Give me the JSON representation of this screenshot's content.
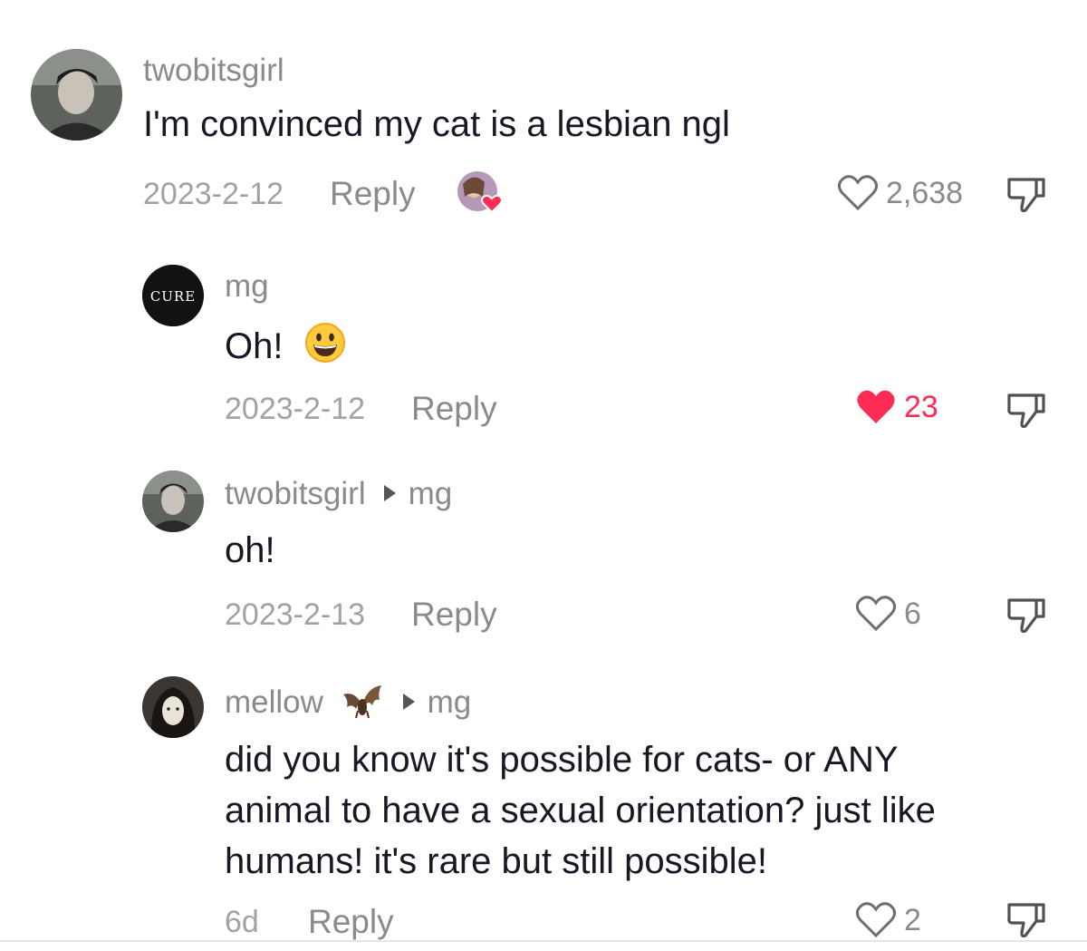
{
  "comments": [
    {
      "username": "twobitsgirl",
      "text": "I'm convinced my cat is a lesbian ngl",
      "date": "2023-2-12",
      "reply_label": "Reply",
      "likes": "2,638",
      "liked": false
    },
    {
      "username": "mg",
      "avatar_text": "CURE",
      "text": "Oh!",
      "emoji": "😀",
      "date": "2023-2-12",
      "reply_label": "Reply",
      "likes": "23",
      "liked": true
    },
    {
      "username": "twobitsgirl",
      "reply_to": "mg",
      "text": "oh!",
      "date": "2023-2-13",
      "reply_label": "Reply",
      "likes": "6",
      "liked": false
    },
    {
      "username": "mellow",
      "badge_emoji": "🦇",
      "reply_to": "mg",
      "text_lines": [
        "did you know it's possible for cats- or ANY",
        "animal to have a sexual orientation? just like",
        "humans! it's rare but still possible!"
      ],
      "date": "6d",
      "reply_label": "Reply",
      "likes": "2",
      "liked": false
    }
  ],
  "icons": {
    "like": "heart-outline-icon",
    "liked": "heart-filled-icon",
    "dislike": "thumbs-down-icon",
    "creator_liked": "creator-liked-avatar-icon"
  },
  "colors": {
    "liked": "#fe2c55",
    "text": "#161823",
    "meta": "#8a8a8a"
  }
}
